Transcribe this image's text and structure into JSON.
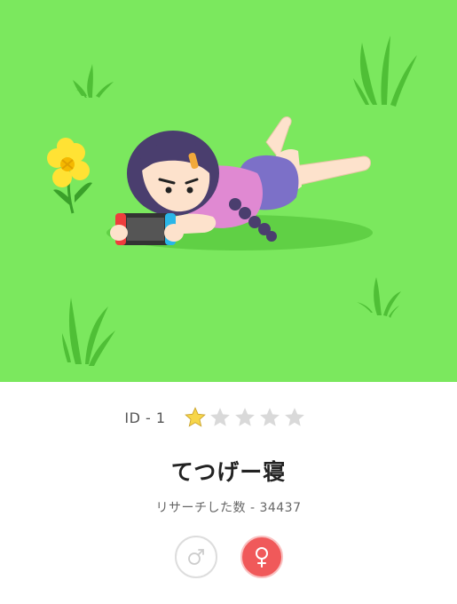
{
  "illustration": {
    "description_icon": "girl-lying-on-grass-playing-game-illustration",
    "grass_color": "#7be85e"
  },
  "record": {
    "id_label": "ID - 1",
    "rating": {
      "filled": 1,
      "total": 5
    },
    "title": "てつげー寝",
    "research_count": "リサーチした数 - 34437"
  },
  "gender": {
    "male_icon": "male-icon",
    "female_icon": "female-icon",
    "selected": "female",
    "selected_color": "#f0595a"
  },
  "colors": {
    "star_filled": "#f7d64a",
    "star_empty": "#d9d9d9"
  }
}
